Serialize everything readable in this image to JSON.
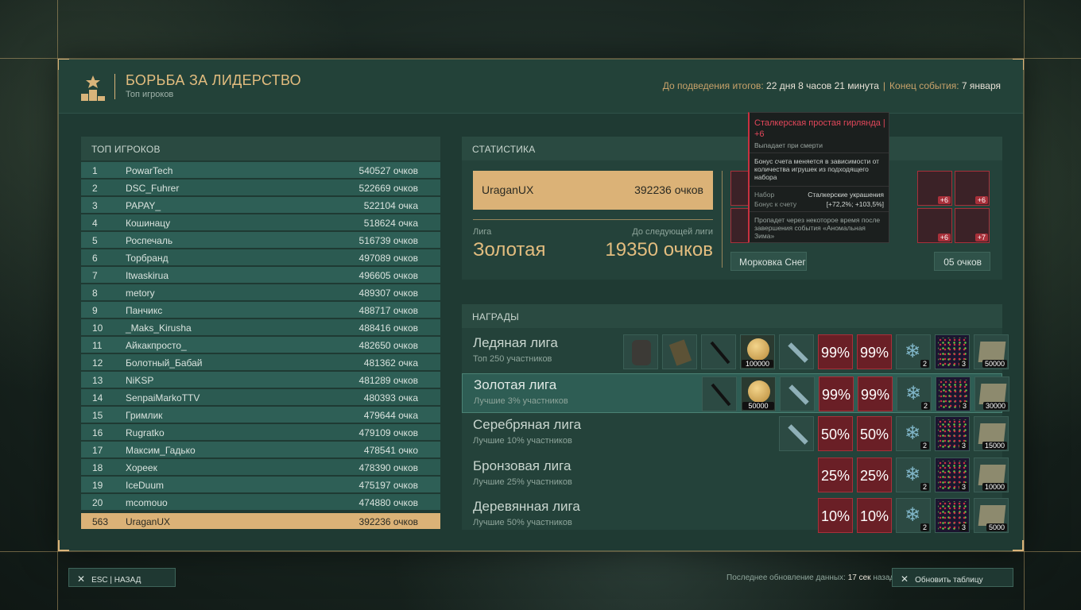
{
  "header": {
    "title": "БОРЬБА ЗА ЛИДЕРСТВО",
    "subtitle": "Топ игроков",
    "countdown_label": "До подведения итогов:",
    "countdown_value": "22 дня 8 часов 21 минута",
    "end_label": "Конец события:",
    "end_value": "7 января"
  },
  "leaderboard": {
    "title": "ТОП ИГРОКОВ",
    "rows": [
      {
        "rank": "1",
        "name": "PowarTech",
        "score": "540527 очков"
      },
      {
        "rank": "2",
        "name": "DSC_Fuhrer",
        "score": "522669 очков"
      },
      {
        "rank": "3",
        "name": "PAPAY_",
        "score": "522104 очка"
      },
      {
        "rank": "4",
        "name": "Кошинацу",
        "score": "518624 очка"
      },
      {
        "rank": "5",
        "name": "Роспечаль",
        "score": "516739 очков"
      },
      {
        "rank": "6",
        "name": "Торбранд",
        "score": "497089 очков"
      },
      {
        "rank": "7",
        "name": "Itwaskirua",
        "score": "496605 очков"
      },
      {
        "rank": "8",
        "name": "metory",
        "score": "489307 очков"
      },
      {
        "rank": "9",
        "name": "Панчикс",
        "score": "488717 очков"
      },
      {
        "rank": "10",
        "name": "_Maks_Kirusha",
        "score": "488416 очков"
      },
      {
        "rank": "11",
        "name": "Айкакпросто_",
        "score": "482650 очков"
      },
      {
        "rank": "12",
        "name": "Болотный_Бабай",
        "score": "481362 очка"
      },
      {
        "rank": "13",
        "name": "NiKSP",
        "score": "481289 очков"
      },
      {
        "rank": "14",
        "name": "SenpaiMarkoTTV",
        "score": "480393 очка"
      },
      {
        "rank": "15",
        "name": "Гримлик",
        "score": "479644 очка"
      },
      {
        "rank": "16",
        "name": "Rugratko",
        "score": "479109 очков"
      },
      {
        "rank": "17",
        "name": "Максим_Гадько",
        "score": "478541 очко"
      },
      {
        "rank": "18",
        "name": "Хореек",
        "score": "478390 очков"
      },
      {
        "rank": "19",
        "name": "IceDuum",
        "score": "475197 очков"
      },
      {
        "rank": "20",
        "name": "mcomouo",
        "score": "474880 очков"
      }
    ],
    "me": {
      "rank": "563",
      "name": "UraganUX",
      "score": "392236 очков"
    }
  },
  "stats": {
    "title": "СТАТИСТИКА",
    "me_name": "UraganUX",
    "me_score": "392236 очков",
    "league_label": "Лига",
    "league_value": "Золотая",
    "next_label": "До следующей лиги",
    "next_value": "19350 очков",
    "slots": [
      "+7",
      "+6",
      "+6",
      "+6",
      "+6",
      "+6",
      "+6",
      "+7"
    ],
    "bonus_left": "Морковка Снег",
    "bonus_right": "05 очков"
  },
  "tooltip": {
    "title": "Сталкерская простая гирлянда",
    "level": "+6",
    "sub": "Выпадает при смерти",
    "desc": "Бонус счета меняется в зависимости от количества игрушек из подходящего набора",
    "set_label": "Набор",
    "set_value": "Сталкерские украшения",
    "bonus_label": "Бонус к счету",
    "bonus_value": "[+72,2%; +103,5%]",
    "footer": "Пропадет через некоторое время после завершения события «Аномальная Зима»"
  },
  "rewards": {
    "title": "НАГРАДЫ",
    "leagues": [
      {
        "name": "Ледяная лига",
        "desc": "Топ 250 участников",
        "pct": "99%",
        "coin": "100000",
        "snow": "2",
        "star": "3",
        "map": "50000"
      },
      {
        "name": "Золотая лига",
        "desc": "Лучшие 3% участников",
        "pct": "99%",
        "coin": "50000",
        "snow": "2",
        "star": "3",
        "map": "30000"
      },
      {
        "name": "Серебряная лига",
        "desc": "Лучшие 10% участников",
        "pct": "50%",
        "snow": "2",
        "star": "3",
        "map": "15000"
      },
      {
        "name": "Бронзовая лига",
        "desc": "Лучшие 25% участников",
        "pct": "25%",
        "snow": "2",
        "star": "3",
        "map": "10000"
      },
      {
        "name": "Деревянная лига",
        "desc": "Лучшие 50% участников",
        "pct": "10%",
        "snow": "2",
        "star": "3",
        "map": "5000"
      }
    ]
  },
  "footer": {
    "back_label": "ESC | НАЗАД",
    "update_label": "Последнее обновление данных:",
    "update_value": "17 сек",
    "update_suffix": "назад",
    "refresh_label": "Обновить таблицу"
  }
}
